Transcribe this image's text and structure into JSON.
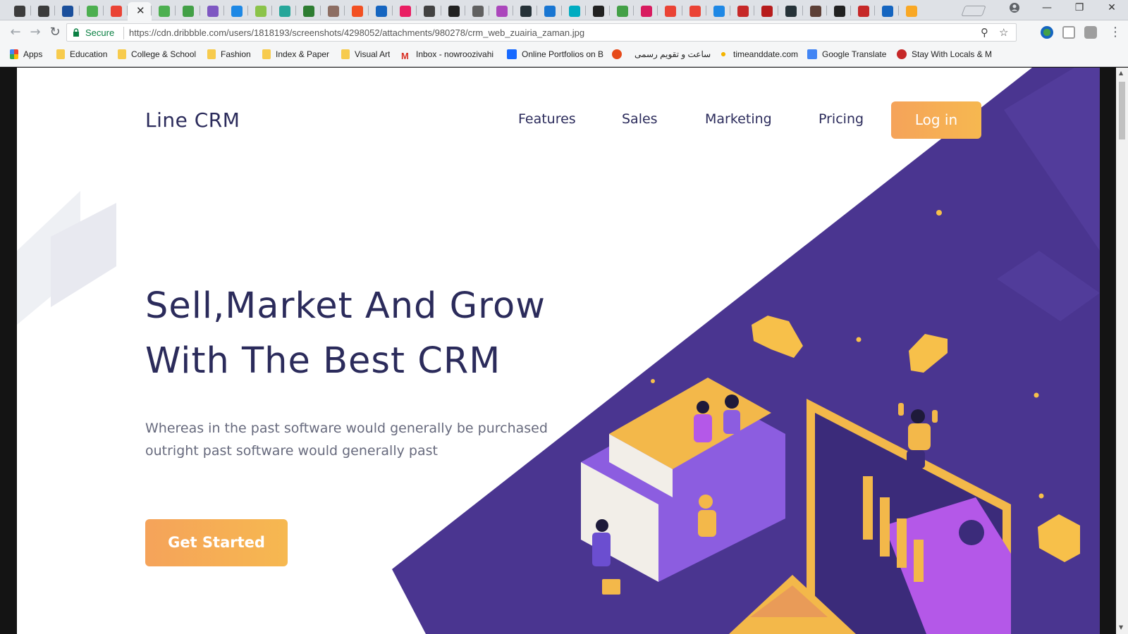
{
  "browser": {
    "tabs": [
      {
        "icon": "menu-app-icon",
        "color": "#3c3c3c"
      },
      {
        "icon": "menu-app-icon",
        "color": "#3c3c3c"
      },
      {
        "icon": "shield-icon",
        "color": "#1a4f9c"
      },
      {
        "icon": "messenger-icon",
        "color": "#4caf50"
      },
      {
        "icon": "photos-icon",
        "color": "#ea4335"
      },
      {
        "icon": "active-tab",
        "color": "#f5f6f7"
      },
      {
        "icon": "leaf-icon",
        "color": "#4caf50"
      },
      {
        "icon": "globe-icon",
        "color": "#43a047"
      },
      {
        "icon": "hootsuite-icon",
        "color": "#7e57c2"
      },
      {
        "icon": "cloud-icon",
        "color": "#1e88e5"
      },
      {
        "icon": "chart-icon",
        "color": "#8bc34a"
      },
      {
        "icon": "sheet-icon",
        "color": "#26a69a"
      },
      {
        "icon": "tree-icon",
        "color": "#2e7d32"
      },
      {
        "icon": "avatar-icon",
        "color": "#8d6e63"
      },
      {
        "icon": "microsoft-icon",
        "color": "#f25022"
      },
      {
        "icon": "arc-icon",
        "color": "#1565c0"
      },
      {
        "icon": "dots-icon",
        "color": "#e91e63"
      },
      {
        "icon": "slash-icon",
        "color": "#424242"
      },
      {
        "icon": "grid-icon",
        "color": "#212121"
      },
      {
        "icon": "pg-icon",
        "color": "#616161"
      },
      {
        "icon": "pen-icon",
        "color": "#ab47bc"
      },
      {
        "icon": "c-icon",
        "color": "#263238"
      },
      {
        "icon": "paren-icon",
        "color": "#1976d2"
      },
      {
        "icon": "wave-icon",
        "color": "#00acc1"
      },
      {
        "icon": "book-icon",
        "color": "#212121"
      },
      {
        "icon": "m-icon",
        "color": "#43a047"
      },
      {
        "icon": "chat-icon",
        "color": "#d81b60"
      },
      {
        "icon": "google-icon",
        "color": "#ea4335"
      },
      {
        "icon": "google-icon",
        "color": "#ea4335"
      },
      {
        "icon": "loading-icon",
        "color": "#1e88e5"
      },
      {
        "icon": "crest-icon",
        "color": "#c62828"
      },
      {
        "icon": "w-icon",
        "color": "#b71c1c"
      },
      {
        "icon": "shield-dark-icon",
        "color": "#263238"
      },
      {
        "icon": "crest-icon",
        "color": "#5d4037"
      },
      {
        "icon": "horse-icon",
        "color": "#212121"
      },
      {
        "icon": "bookmark-red-icon",
        "color": "#c62828"
      },
      {
        "icon": "w3-icon",
        "color": "#1565c0"
      },
      {
        "icon": "coin-icon",
        "color": "#f9a825"
      }
    ],
    "close_glyph": "✕",
    "secure_label": "Secure",
    "url": "https://cdn.dribbble.com/users/1818193/screenshots/4298052/attachments/980278/crm_web_zuairia_zaman.jpg",
    "bookmarks": [
      {
        "label": "Apps",
        "icon": "apps-grid-icon"
      },
      {
        "label": "Education",
        "icon": "folder-icon"
      },
      {
        "label": "College & School",
        "icon": "folder-icon"
      },
      {
        "label": "Fashion",
        "icon": "folder-icon"
      },
      {
        "label": "Index & Paper",
        "icon": "folder-icon"
      },
      {
        "label": "Visual Art",
        "icon": "folder-icon"
      },
      {
        "label": "Inbox - nowroozivahi",
        "icon": "gmail-icon"
      },
      {
        "label": "Online Portfolios on B",
        "icon": "behance-icon"
      },
      {
        "label": "",
        "icon": "t-icon"
      },
      {
        "label": "ساعت و تقویم رسمی",
        "icon": "none"
      },
      {
        "label": "timeanddate.com",
        "icon": "dots-icon"
      },
      {
        "label": "Google Translate",
        "icon": "translate-icon"
      },
      {
        "label": "Stay With Locals & M",
        "icon": "globe-red-icon"
      }
    ]
  },
  "site": {
    "brand": "Line CRM",
    "nav": [
      "Features",
      "Sales",
      "Marketing",
      "Pricing"
    ],
    "login": "Log in",
    "headline_line1": "Sell,Market And Grow",
    "headline_line2": "With The Best CRM",
    "subtext_line1": "Whereas in the past software would generally be purchased",
    "subtext_line2": "outright  past software would generally past",
    "cta": "Get Started"
  },
  "colors": {
    "brand_text": "#2b2b5b",
    "purple_bg": "#4a3590",
    "orange_accent": "#f5a35a",
    "yellow": "#f7c04a"
  }
}
